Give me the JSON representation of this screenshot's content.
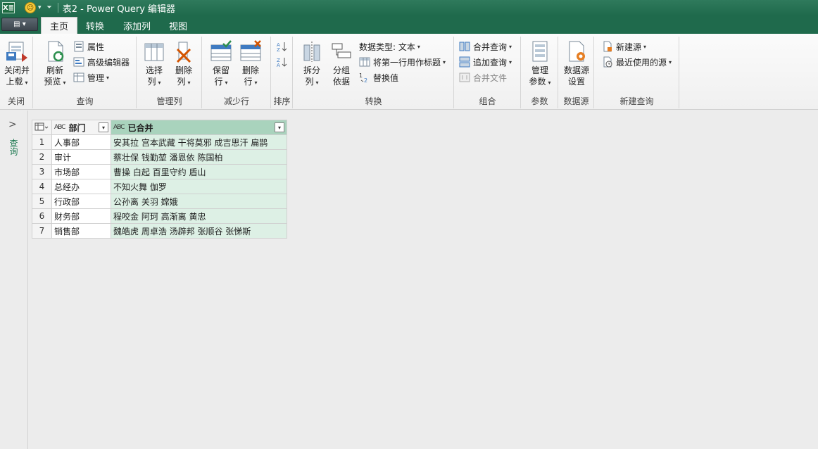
{
  "window": {
    "title": "表2 - Power Query 编辑器",
    "app_icon": "X≣"
  },
  "tabs": [
    {
      "label": "主页",
      "active": true
    },
    {
      "label": "转换",
      "active": false
    },
    {
      "label": "添加列",
      "active": false
    },
    {
      "label": "视图",
      "active": false
    }
  ],
  "file_button": {
    "icon": "document-menu-icon"
  },
  "ribbon": {
    "close": {
      "group": "关闭",
      "btn_line1": "关闭并",
      "btn_line2": "上载"
    },
    "query": {
      "group": "查询",
      "refresh_line1": "刷新",
      "refresh_line2": "预览",
      "properties": "属性",
      "advanced": "高级编辑器",
      "manage": "管理"
    },
    "manage_cols": {
      "group": "管理列",
      "choose_line1": "选择",
      "choose_line2": "列",
      "remove_line1": "删除",
      "remove_line2": "列"
    },
    "reduce_rows": {
      "group": "减少行",
      "keep_line1": "保留",
      "keep_line2": "行",
      "remove_line1": "删除",
      "remove_line2": "行"
    },
    "sort": {
      "group": "排序"
    },
    "transform": {
      "group": "转换",
      "split_line1": "拆分",
      "split_line2": "列",
      "groupby_line1": "分组",
      "groupby_line2": "依据",
      "datatype": "数据类型: 文本",
      "first_row": "将第一行用作标题",
      "replace": "替换值"
    },
    "combine": {
      "group": "组合",
      "merge": "合并查询",
      "append": "追加查询",
      "combine_files": "合并文件"
    },
    "params": {
      "group": "参数",
      "manage_line1": "管理",
      "manage_line2": "参数"
    },
    "datasource": {
      "group": "数据源",
      "settings_line1": "数据源",
      "settings_line2": "设置"
    },
    "newquery": {
      "group": "新建查询",
      "new_source": "新建源",
      "recent": "最近使用的源"
    }
  },
  "leftnav": {
    "label": "查询"
  },
  "grid": {
    "columns": [
      {
        "type": "ABC",
        "name": "部门"
      },
      {
        "type": "ABC",
        "name": "已合并"
      }
    ],
    "rows": [
      {
        "num": "1",
        "dept": "人事部",
        "merged": "安其拉 宫本武藏 干将莫邪 成吉思汗 扁鹊"
      },
      {
        "num": "2",
        "dept": "审计",
        "merged": "蔡壮保 钱勤堃 潘恩依 陈国柏"
      },
      {
        "num": "3",
        "dept": "市场部",
        "merged": "曹操 白起 百里守约 盾山"
      },
      {
        "num": "4",
        "dept": "总经办",
        "merged": "不知火舞 伽罗"
      },
      {
        "num": "5",
        "dept": "行政部",
        "merged": "公孙离 关羽 嫦娥"
      },
      {
        "num": "6",
        "dept": "财务部",
        "merged": "程咬金 阿珂 高渐离 黄忠"
      },
      {
        "num": "7",
        "dept": "销售部",
        "merged": "魏皓虎 周卓浩 汤辟邦 张顺谷 张悌斯"
      }
    ]
  }
}
